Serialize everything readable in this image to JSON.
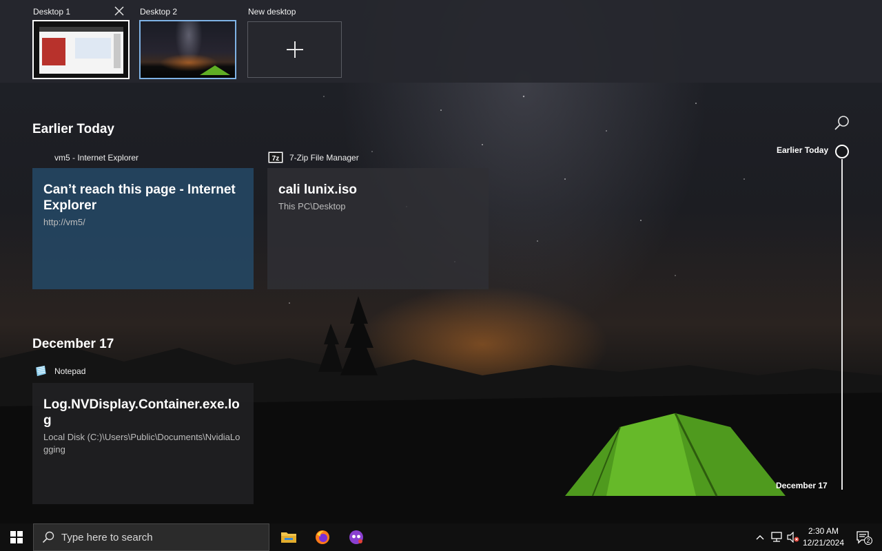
{
  "desktops": [
    {
      "label": "Desktop 1",
      "selected": false,
      "has_close": true
    },
    {
      "label": "Desktop 2",
      "selected": true
    },
    {
      "label": "New desktop"
    }
  ],
  "timeline": {
    "sections": [
      {
        "title": "Earlier Today",
        "cards": [
          {
            "app": "vm5 - Internet Explorer",
            "app_icon": "internet-explorer-icon",
            "title": "Can’t reach this page - Internet Explorer",
            "subtitle": "http://vm5/",
            "color": "#244864"
          },
          {
            "app": "7-Zip File Manager",
            "app_icon": "7zip-icon",
            "title": "cali lunix.iso",
            "subtitle": "This PC\\Desktop",
            "color": "#303034"
          }
        ]
      },
      {
        "title": "December 17",
        "cards": [
          {
            "app": "Notepad",
            "app_icon": "notepad-icon",
            "title": "Log.NVDisplay.Container.exe.log",
            "subtitle": "Local Disk (C:)\\Users\\Public\\Documents\\NvidiaLogging",
            "color": "#222224"
          }
        ]
      }
    ],
    "scrubber": {
      "top_label": "Earlier Today",
      "bottom_label": "December 17"
    }
  },
  "taskbar": {
    "search_placeholder": "Type here to search",
    "apps": [
      "file-explorer-icon",
      "firefox-icon",
      "tor-browser-icon"
    ],
    "tray_icons": [
      "chevron-up-icon",
      "network-icon",
      "volume-muted-icon"
    ],
    "clock": {
      "time": "2:30 AM",
      "date": "12/21/2024"
    },
    "notification_count": "2"
  }
}
